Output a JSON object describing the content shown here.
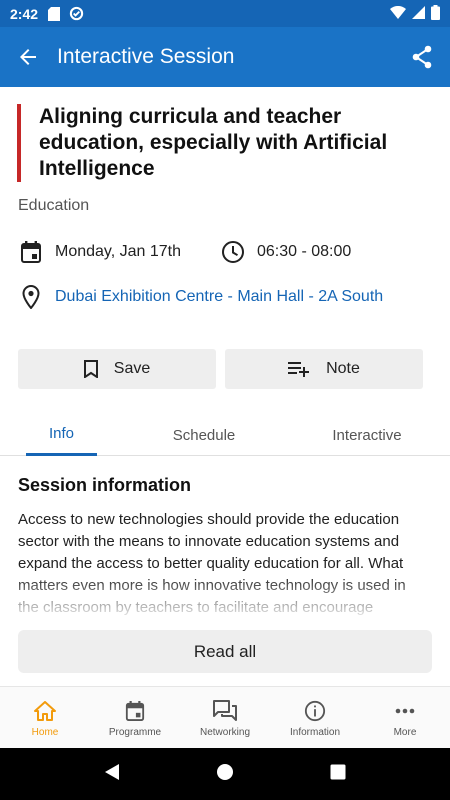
{
  "status_bar": {
    "time": "2:42"
  },
  "app_bar": {
    "title": "Interactive Session"
  },
  "session": {
    "title": "Aligning curricula and teacher education, especially with Artificial Intelligence",
    "category": "Education",
    "date": "Monday, Jan 17th",
    "time": "06:30 - 08:00",
    "location": "Dubai Exhibition Centre - Main Hall - 2A South"
  },
  "actions": {
    "save_label": "Save",
    "note_label": "Note"
  },
  "tabs": [
    {
      "label": "Info",
      "active": true
    },
    {
      "label": "Schedule",
      "active": false
    },
    {
      "label": "Interactive",
      "active": false
    }
  ],
  "info": {
    "section_title": "Session information",
    "description": "Access to new technologies should provide the education sector with the means to innovate education systems and expand the access to better quality education for all. What matters even more is how innovative technology is used in the classroom by teachers to facilitate and encourage",
    "read_all_label": "Read all"
  },
  "bottom_nav": [
    {
      "label": "Home",
      "icon": "home-icon",
      "active": true
    },
    {
      "label": "Programme",
      "icon": "calendar-icon",
      "active": false
    },
    {
      "label": "Networking",
      "icon": "chat-icon",
      "active": false
    },
    {
      "label": "Information",
      "icon": "info-icon",
      "active": false
    },
    {
      "label": "More",
      "icon": "more-icon",
      "active": false
    }
  ],
  "colors": {
    "primary": "#1a73c6",
    "status_bar": "#1565b5",
    "accent_bar": "#c62828",
    "active_nav": "#f29b0c"
  }
}
